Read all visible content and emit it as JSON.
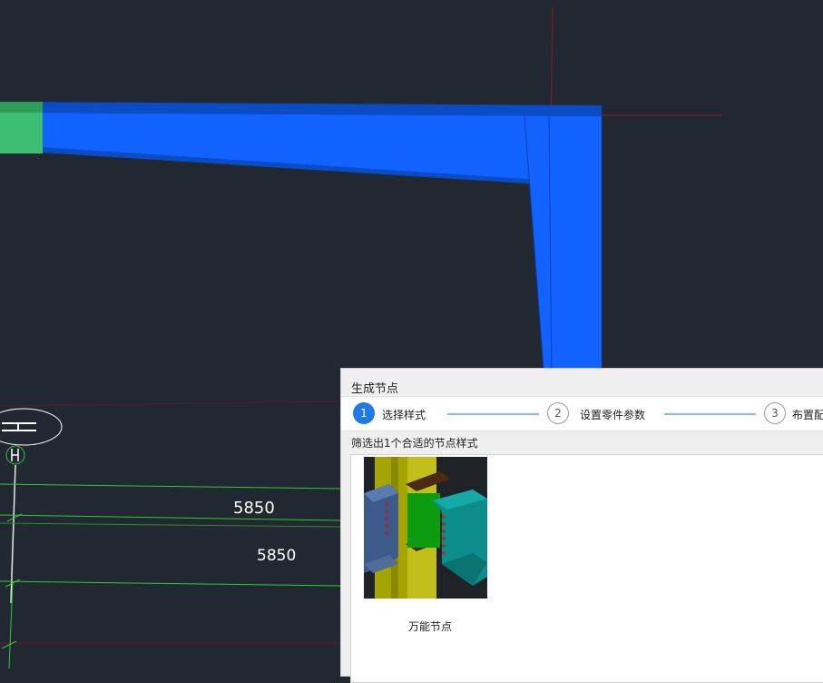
{
  "canvas": {
    "dimension_labels": [
      "5850",
      "5850"
    ],
    "colors": {
      "background": "#222831",
      "beam": "#1262ff",
      "beam_dark": "#0a4cc4",
      "green_part": "#3cbf73",
      "axis_red": "#8b1a22",
      "grid_green": "#35c63a"
    }
  },
  "dialog": {
    "title": "生成节点",
    "steps": [
      {
        "number": "1",
        "label": "选择样式",
        "active": true
      },
      {
        "number": "2",
        "label": "设置零件参数",
        "active": false
      },
      {
        "number": "3",
        "label": "布置配",
        "active": false
      }
    ],
    "filter_text": "筛选出1个合适的节点样式",
    "node_styles": [
      {
        "label": "万能节点"
      }
    ]
  }
}
